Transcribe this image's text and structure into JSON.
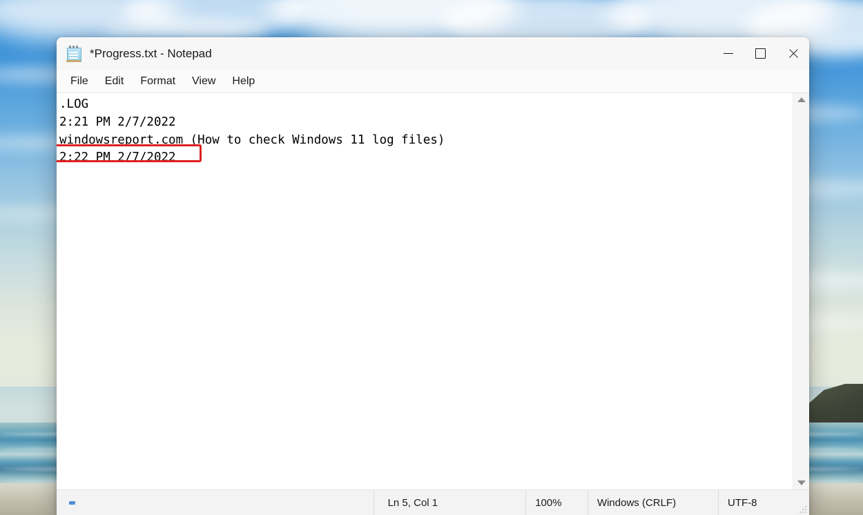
{
  "window": {
    "title": "*Progress.txt - Notepad",
    "app_icon": "notepad-icon",
    "controls": {
      "minimize": "minimize-icon",
      "maximize": "maximize-icon",
      "close": "close-icon"
    }
  },
  "menubar": {
    "items": [
      {
        "label": "File"
      },
      {
        "label": "Edit"
      },
      {
        "label": "Format"
      },
      {
        "label": "View"
      },
      {
        "label": "Help"
      }
    ]
  },
  "editor": {
    "lines": [
      ".LOG",
      "2:21 PM 2/7/2022",
      "windowsreport.com (How to check Windows 11 log files)",
      "2:22 PM 2/7/2022"
    ],
    "highlight": {
      "line_index": 3,
      "color": "#e02020"
    },
    "scrollbar": {
      "up_arrow": "scroll-up-icon",
      "down_arrow": "scroll-down-icon"
    }
  },
  "statusbar": {
    "position": "Ln 5, Col 1",
    "zoom": "100%",
    "line_ending": "Windows (CRLF)",
    "encoding": "UTF-8"
  },
  "desktop": {
    "wallpaper": "beach-ocean-wallpaper",
    "sky_color": "#2f8bd6",
    "sand_color": "#cfcdbd",
    "ocean_color": "#4f93b3"
  }
}
